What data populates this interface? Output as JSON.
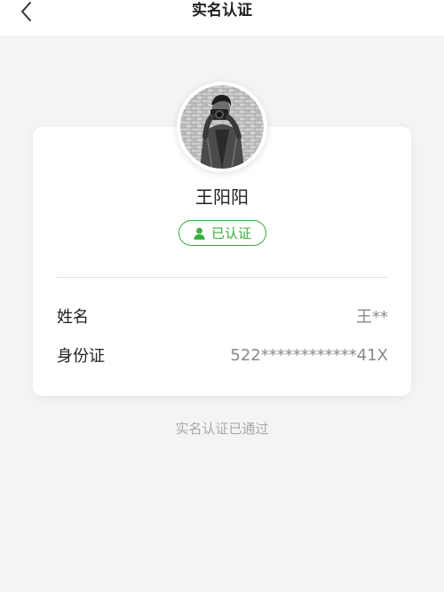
{
  "header": {
    "title": "实名认证",
    "back_icon": "chevron-left-icon"
  },
  "profile": {
    "avatar_icon": "user-photo-avatar",
    "name": "王阳阳",
    "verified_icon": "person-icon",
    "verified_label": "已认证",
    "verified_color": "#3cae3c"
  },
  "info": {
    "rows": [
      {
        "label": "姓名",
        "value": "王**"
      },
      {
        "label": "身份证",
        "value": "522************41X"
      }
    ]
  },
  "footer": {
    "note": "实名认证已通过"
  }
}
